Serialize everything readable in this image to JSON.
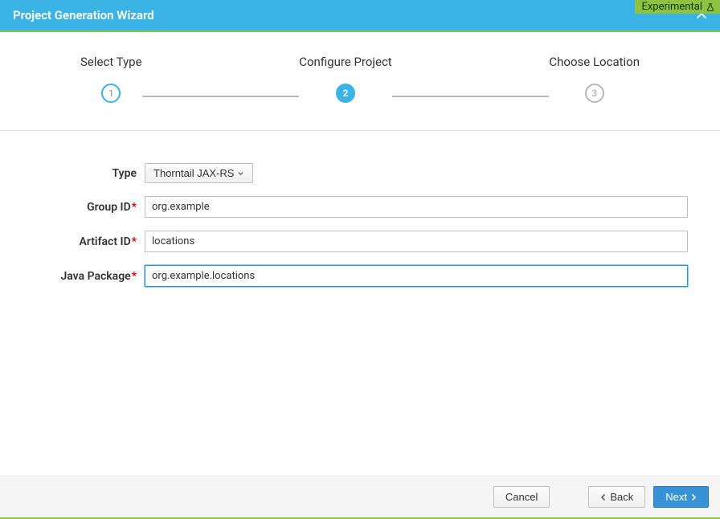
{
  "badge": {
    "label": "Experimental"
  },
  "header": {
    "title": "Project Generation Wizard"
  },
  "stepper": {
    "steps": [
      {
        "label": "Select Type",
        "num": "1"
      },
      {
        "label": "Configure Project",
        "num": "2"
      },
      {
        "label": "Choose Location",
        "num": "3"
      }
    ]
  },
  "form": {
    "type": {
      "label": "Type",
      "value": "Thorntail JAX-RS"
    },
    "group_id": {
      "label": "Group ID",
      "value": "org.example"
    },
    "artifact_id": {
      "label": "Artifact ID",
      "value": "locations"
    },
    "java_package": {
      "label": "Java Package",
      "value": "org.example.locations"
    }
  },
  "footer": {
    "cancel": "Cancel",
    "back": "Back",
    "next": "Next"
  }
}
